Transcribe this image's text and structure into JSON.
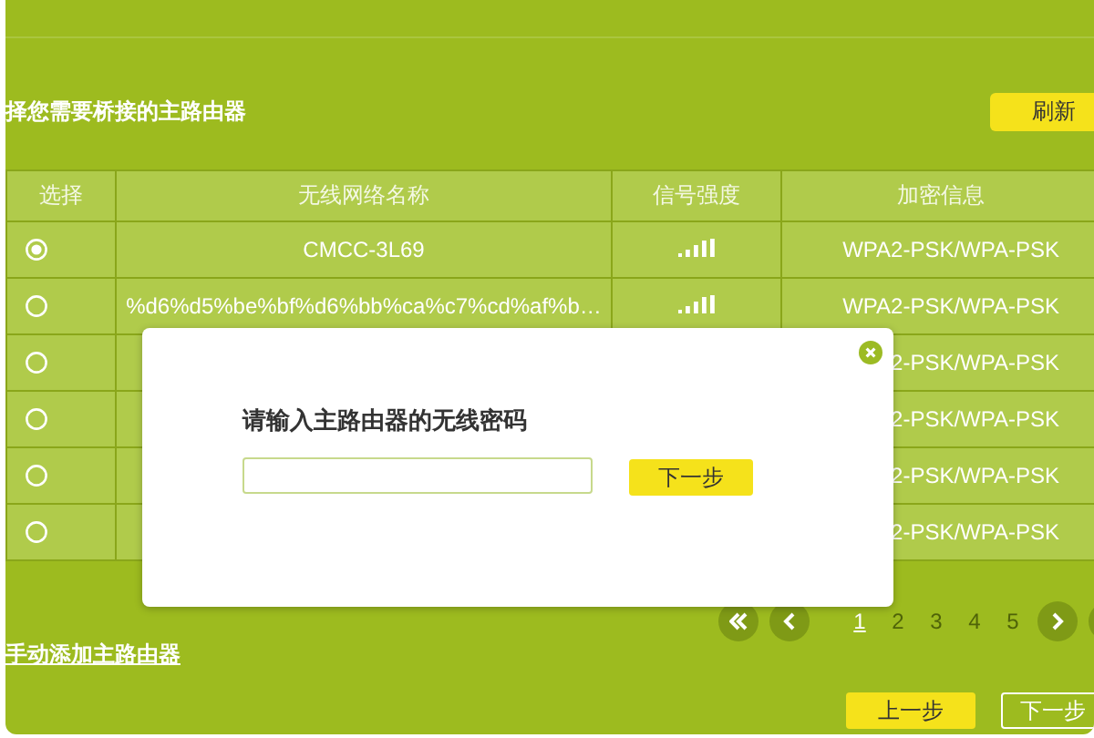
{
  "prompt": "择您需要桥接的主路由器",
  "refresh_button": "刷新",
  "table": {
    "columns": [
      "选择",
      "无线网络名称",
      "信号强度",
      "加密信息"
    ],
    "rows": [
      {
        "selected": true,
        "name": "CMCC-3L69",
        "encryption": "WPA2-PSK/WPA-PSK"
      },
      {
        "selected": false,
        "name": "%d6%d5%be%bf%d6%bb%ca%c7%cd%af%b…",
        "encryption": "WPA2-PSK/WPA-PSK"
      },
      {
        "selected": false,
        "encryption": "2-PSK/WPA-PSK"
      },
      {
        "selected": false,
        "encryption": "2-PSK/WPA-PSK"
      },
      {
        "selected": false,
        "encryption": "2-PSK/WPA-PSK"
      },
      {
        "selected": false,
        "encryption": "2-PSK/WPA-PSK"
      }
    ]
  },
  "pagination": {
    "pages": [
      {
        "label": "1",
        "selected": true
      },
      {
        "label": "2",
        "selected": false
      },
      {
        "label": "3",
        "selected": false
      },
      {
        "label": "4",
        "selected": false
      },
      {
        "label": "5",
        "selected": false
      }
    ]
  },
  "manual_add_link": "手动添加主路由器",
  "back_button": "上一步",
  "next_button": "下一步",
  "dialog": {
    "title": "请输入主路由器的无线密码",
    "next_button": "下一步"
  }
}
